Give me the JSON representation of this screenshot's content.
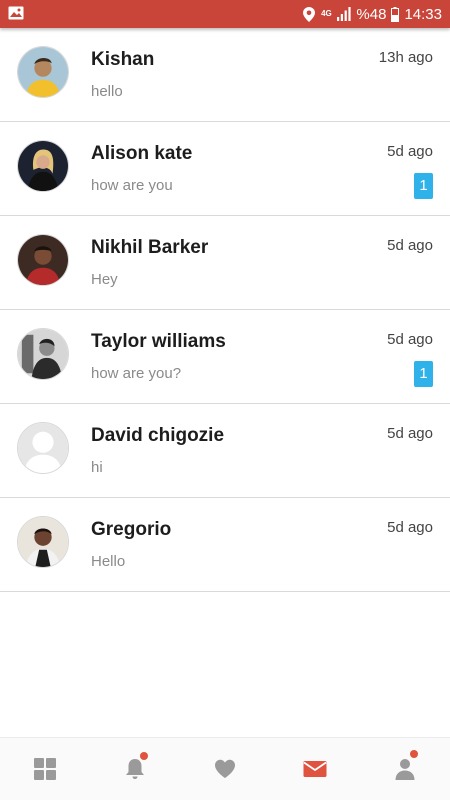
{
  "status_bar": {
    "battery": "%48",
    "time": "14:33",
    "network": "4G",
    "icons": [
      "gallery-icon",
      "location-icon",
      "network-4g-icon",
      "signal-icon",
      "battery-icon"
    ]
  },
  "conversations": [
    {
      "name": "Kishan",
      "preview": "hello",
      "time": "13h ago",
      "unread": ""
    },
    {
      "name": "Alison kate",
      "preview": "how are you",
      "time": "5d ago",
      "unread": "1"
    },
    {
      "name": "Nikhil Barker",
      "preview": "Hey",
      "time": "5d ago",
      "unread": ""
    },
    {
      "name": "Taylor williams",
      "preview": "how are you?",
      "time": "5d ago",
      "unread": "1"
    },
    {
      "name": "David chigozie",
      "preview": "hi",
      "time": "5d ago",
      "unread": ""
    },
    {
      "name": "Gregorio",
      "preview": "Hello",
      "time": "5d ago",
      "unread": ""
    }
  ],
  "bottom_nav": [
    {
      "icon": "grid-icon",
      "active": false,
      "dot": false
    },
    {
      "icon": "bell-icon",
      "active": false,
      "dot": true
    },
    {
      "icon": "heart-icon",
      "active": false,
      "dot": false
    },
    {
      "icon": "envelope-icon",
      "active": true,
      "dot": false
    },
    {
      "icon": "profile-icon",
      "active": false,
      "dot": true
    }
  ],
  "colors": {
    "status_bar": "#c9453a",
    "accent": "#e0533f",
    "badge": "#2fb1ea",
    "nav_inactive": "#9a9a9a"
  }
}
